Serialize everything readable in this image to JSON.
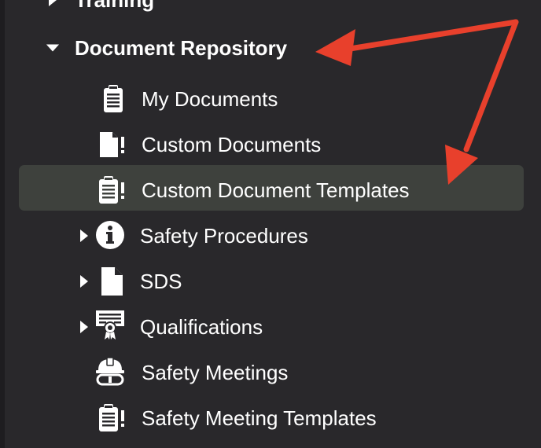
{
  "nav": {
    "training": {
      "label": "Training"
    },
    "document_repository": {
      "label": "Document Repository",
      "expanded": true,
      "children": [
        {
          "label": "My Documents",
          "icon": "clipboard-list-icon"
        },
        {
          "label": "Custom Documents",
          "icon": "file-exclamation-icon"
        },
        {
          "label": "Custom Document Templates",
          "icon": "clipboard-exclamation-icon",
          "selected": true
        },
        {
          "label": "Safety Procedures",
          "icon": "info-circle-icon",
          "expandable": true
        },
        {
          "label": "SDS",
          "icon": "file-icon",
          "expandable": true
        },
        {
          "label": "Qualifications",
          "icon": "certificate-icon",
          "expandable": true
        },
        {
          "label": "Safety Meetings",
          "icon": "hard-hat-icon"
        },
        {
          "label": "Safety Meeting Templates",
          "icon": "clipboard-exclamation-icon"
        }
      ]
    }
  },
  "colors": {
    "background": "#29282b",
    "selected_row": "#3e413d",
    "annotation_arrow": "#e8402c",
    "text": "#ffffff"
  }
}
